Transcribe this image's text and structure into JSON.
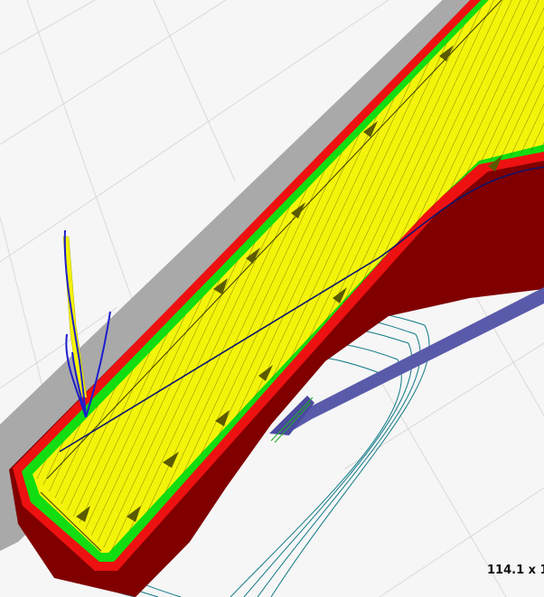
{
  "viewer": {
    "dimensions_readout": "114.1 x 1"
  },
  "colors": {
    "background": "#f6f6f6",
    "grid": "#d9d9d9",
    "shadow": "#a9a9a9",
    "outer_perimeter": "#ee1111",
    "lower_layer": "#800000",
    "inner_perimeter": "#11dd11",
    "infill": "#f4f40a",
    "infill_lines": "#3a3a00",
    "travel_move": "#0a1570",
    "retract_moves": "#1e1ecc",
    "wipe_move": "#5a5aaa",
    "skirt": "#117a88"
  },
  "icons": [
    "travel-arrow-icon"
  ]
}
